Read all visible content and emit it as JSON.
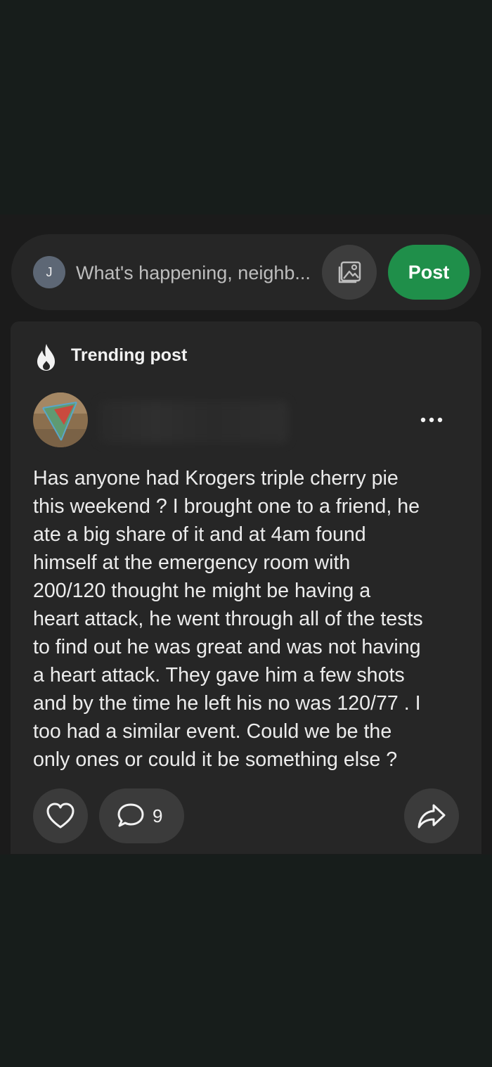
{
  "colors": {
    "page_background": "#171d1b",
    "app_background": "#1b1b1b",
    "card_background": "#262626",
    "button_background": "#3b3b3b",
    "accent_green": "#1f8f4a",
    "text_primary": "#ececec",
    "placeholder_text": "#bdbdbd",
    "composer_avatar": "#5d6775"
  },
  "composer": {
    "avatar_initial": "J",
    "placeholder": "What's happening, neighb...",
    "photo_icon": "image-gallery-icon",
    "post_label": "Post"
  },
  "trending_post": {
    "header_icon": "flame-icon",
    "header_label": "Trending post",
    "author_avatar_icon": "author-photo",
    "more_icon": "more-options-icon",
    "body": "Has anyone had Krogers triple cherry pie\nthis weekend ?  I brought one to a friend, he\nate a big share of it and at 4am found\nhimself at the emergency room with\n200/120 thought he might be having a\nheart attack, he went through all of the tests\nto find out he was great and was not having\na heart attack. They gave him a few shots\nand by the time he left his no was 120/77 . I\ntoo had a similar event. Could we be the\nonly ones or could it be something else ?",
    "actions": {
      "like_icon": "heart-icon",
      "comment_icon": "comment-bubble-icon",
      "comment_count": "9",
      "share_icon": "share-arrow-icon"
    }
  }
}
